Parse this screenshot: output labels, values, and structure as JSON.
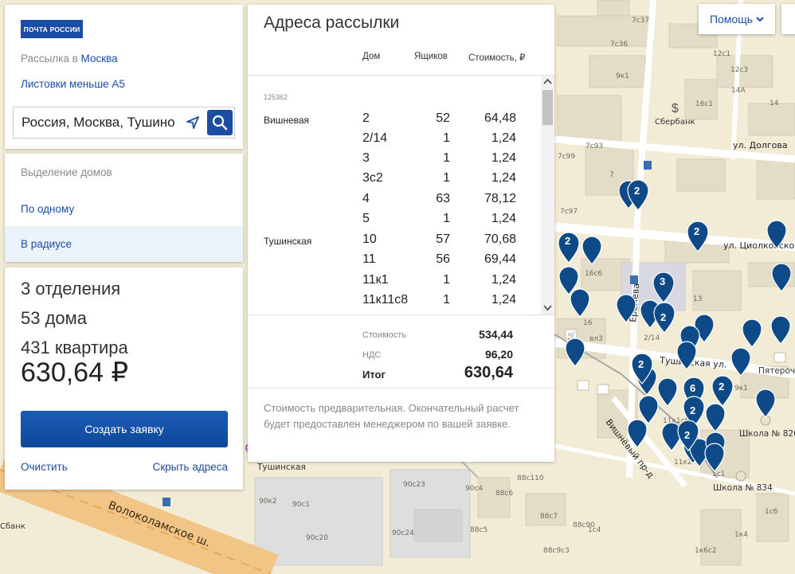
{
  "brand": {
    "logo_text": "ПОЧТА РОССИИ"
  },
  "mailing": {
    "prefix": "Рассылка в",
    "city": "Москва",
    "format": "Листовки меньше А5"
  },
  "search": {
    "value": "Россия, Москва, Тушино"
  },
  "selection": {
    "title": "Выделение домов",
    "option_one": "По одному",
    "option_radius": "В радиусе"
  },
  "summary": {
    "offices": "3 отделения",
    "houses": "53 дома",
    "apartments": "431 квартира",
    "total": "630,64 ₽",
    "create_button": "Создать заявку",
    "clear_link": "Очистить",
    "hide_link": "Скрыть адреса"
  },
  "addresses": {
    "title": "Адреса рассылки",
    "col_house": "Дом",
    "col_boxes": "Ящиков",
    "col_cost": "Стоимость, ₽",
    "postcode": "125362",
    "rows": [
      {
        "street": "Вишневая",
        "house": "2",
        "boxes": "52",
        "cost": "64,48"
      },
      {
        "street": "",
        "house": "2/14",
        "boxes": "1",
        "cost": "1,24"
      },
      {
        "street": "",
        "house": "3",
        "boxes": "1",
        "cost": "1,24"
      },
      {
        "street": "",
        "house": "3с2",
        "boxes": "1",
        "cost": "1,24"
      },
      {
        "street": "",
        "house": "4",
        "boxes": "63",
        "cost": "78,12"
      },
      {
        "street": "",
        "house": "5",
        "boxes": "1",
        "cost": "1,24"
      },
      {
        "street": "Тушинская",
        "house": "10",
        "boxes": "57",
        "cost": "70,68"
      },
      {
        "street": "",
        "house": "11",
        "boxes": "56",
        "cost": "69,44"
      },
      {
        "street": "",
        "house": "11к1",
        "boxes": "1",
        "cost": "1,24"
      },
      {
        "street": "",
        "house": "11к11с8",
        "boxes": "1",
        "cost": "1,24"
      }
    ],
    "cost_label": "Стоимость",
    "cost_value": "534,44",
    "vat_label": "НДС",
    "vat_value": "96,20",
    "total_label": "Итог",
    "total_value": "630,64",
    "note": "Стоимость предварительная. Окончательный расчет будет предоставлен менеджером по вашей заявке."
  },
  "help": {
    "label": "Помощь"
  },
  "map": {
    "streets": {
      "dolgova": "ул. Долгова",
      "tsiolkovskogo": "ул. Циолковского",
      "tushinskaya": "Тушинская ул.",
      "volokolamskoe": "Волоколамское ш.",
      "vishnevy": "Вишнёвый пр-д",
      "yerevskaya": "Ерёмева"
    },
    "places": {
      "sberbank": "Сбербанк",
      "school_820": "Школа № 820",
      "school_834": "Школа № 834",
      "pyaterochka": "Пятерочка",
      "tushinskaya_station": "Тушинская",
      "sbank_left": "Сбанк"
    },
    "house_labels": [
      "7с36",
      "7с37",
      "9к1",
      "12с1",
      "12с3",
      "14А",
      "16с1",
      "14",
      "7с93",
      "7с99",
      "7",
      "7с97",
      "16с6",
      "16",
      "2/14",
      "вл3",
      "13",
      "11к1с6",
      "11к2",
      "1с1",
      "9к1",
      "1с6",
      "1к4",
      "1к6с2",
      "90с23",
      "90с4",
      "88с6",
      "90с1",
      "90с20",
      "90с24",
      "88с5",
      "88с90",
      "88с9с3",
      "90к2",
      "88с110",
      "88с7",
      "1с4"
    ],
    "clusters": [
      "2",
      "2",
      "3",
      "2",
      "2",
      "2",
      "6",
      "2",
      "2",
      "2"
    ]
  }
}
